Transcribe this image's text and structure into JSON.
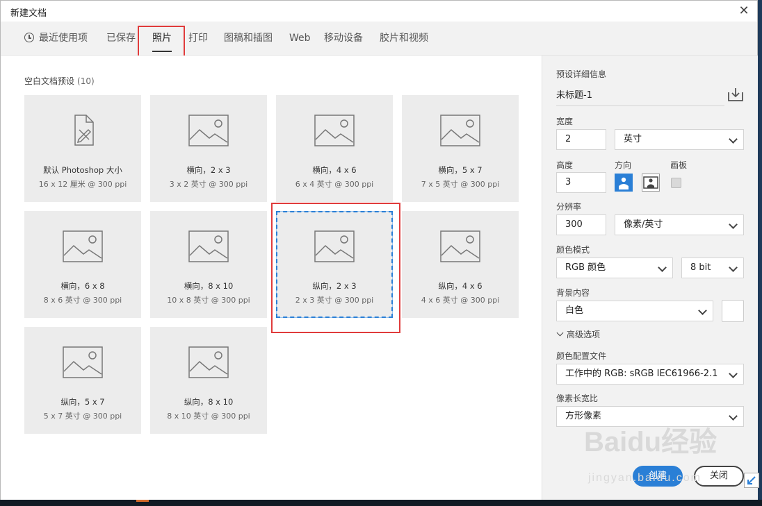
{
  "dialog": {
    "title": "新建文档",
    "close_glyph": "✕"
  },
  "tabs": [
    {
      "label": "最近使用项",
      "icon": "clock-icon"
    },
    {
      "label": "已保存"
    },
    {
      "label": "照片",
      "active": true
    },
    {
      "label": "打印"
    },
    {
      "label": "图稿和插图"
    },
    {
      "label": "Web"
    },
    {
      "label": "移动设备"
    },
    {
      "label": "胶片和视频"
    }
  ],
  "presets": {
    "section_label": "空白文档预设",
    "count": "(10)",
    "cards": [
      {
        "name": "默认 Photoshop 大小",
        "size": "16 x 12 厘米 @ 300 ppi",
        "icon": "document-pencil-icon"
      },
      {
        "name": "横向，2 x 3",
        "size": "3 x 2 英寸 @ 300 ppi",
        "icon": "landscape-image-icon"
      },
      {
        "name": "横向，4 x 6",
        "size": "6 x 4 英寸 @ 300 ppi",
        "icon": "landscape-image-icon"
      },
      {
        "name": "横向，5 x 7",
        "size": "7 x 5 英寸 @ 300 ppi",
        "icon": "landscape-image-icon"
      },
      {
        "name": "横向，6 x 8",
        "size": "8 x 6 英寸 @ 300 ppi",
        "icon": "landscape-image-icon"
      },
      {
        "name": "横向，8 x 10",
        "size": "10 x 8 英寸 @ 300 ppi",
        "icon": "landscape-image-icon"
      },
      {
        "name": "纵向，2 x 3",
        "size": "2 x 3 英寸 @ 300 ppi",
        "icon": "landscape-image-icon",
        "selected": true
      },
      {
        "name": "纵向，4 x 6",
        "size": "4 x 6 英寸 @ 300 ppi",
        "icon": "landscape-image-icon"
      },
      {
        "name": "纵向，5 x 7",
        "size": "5 x 7 英寸 @ 300 ppi",
        "icon": "landscape-image-icon"
      },
      {
        "name": "纵向，8 x 10",
        "size": "8 x 10 英寸 @ 300 ppi",
        "icon": "landscape-image-icon"
      }
    ]
  },
  "details": {
    "header": "预设详细信息",
    "doc_name": "未标题-1",
    "width_label": "宽度",
    "width_value": "2",
    "width_unit": "英寸",
    "height_label": "高度",
    "height_value": "3",
    "orientation_label": "方向",
    "artboard_label": "画板",
    "resolution_label": "分辨率",
    "resolution_value": "300",
    "resolution_unit": "像素/英寸",
    "color_mode_label": "颜色模式",
    "color_mode_value": "RGB 颜色",
    "bit_depth": "8 bit",
    "background_label": "背景内容",
    "background_value": "白色",
    "advanced_label": "高级选项",
    "profile_label": "颜色配置文件",
    "profile_value": "工作中的 RGB: sRGB IEC61966-2.1",
    "aspect_label": "像素长宽比",
    "aspect_value": "方形像素",
    "create_label": "创建",
    "close_label": "关闭"
  },
  "watermark": {
    "line1": "Baidu经验",
    "line2": "jingyan.baidu.com"
  },
  "colors": {
    "accent": "#2a7fd6",
    "highlight": "#e03b3b",
    "card_bg": "#ececec",
    "panel_bg": "#f2f2f2"
  }
}
